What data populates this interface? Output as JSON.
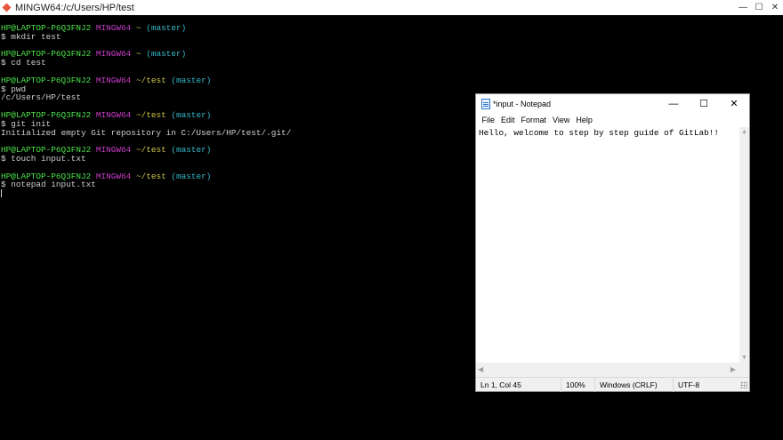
{
  "terminal": {
    "title": "MINGW64:/c/Users/HP/test",
    "lines": [
      {
        "kind": "prompt",
        "user": "HP@LAPTOP-P6Q3FNJ2",
        "sys": "MINGW64",
        "path": "~",
        "branch": "(master)"
      },
      {
        "kind": "cmd",
        "text": "$ mkdir test"
      },
      {
        "kind": "blank"
      },
      {
        "kind": "prompt",
        "user": "HP@LAPTOP-P6Q3FNJ2",
        "sys": "MINGW64",
        "path": "~",
        "branch": "(master)"
      },
      {
        "kind": "cmd",
        "text": "$ cd test"
      },
      {
        "kind": "blank"
      },
      {
        "kind": "prompt",
        "user": "HP@LAPTOP-P6Q3FNJ2",
        "sys": "MINGW64",
        "path": "~/test",
        "branch": "(master)"
      },
      {
        "kind": "cmd",
        "text": "$ pwd"
      },
      {
        "kind": "out",
        "text": "/c/Users/HP/test"
      },
      {
        "kind": "blank"
      },
      {
        "kind": "prompt",
        "user": "HP@LAPTOP-P6Q3FNJ2",
        "sys": "MINGW64",
        "path": "~/test",
        "branch": "(master)"
      },
      {
        "kind": "cmd",
        "text": "$ git init"
      },
      {
        "kind": "out",
        "text": "Initialized empty Git repository in C:/Users/HP/test/.git/"
      },
      {
        "kind": "blank"
      },
      {
        "kind": "prompt",
        "user": "HP@LAPTOP-P6Q3FNJ2",
        "sys": "MINGW64",
        "path": "~/test",
        "branch": "(master)"
      },
      {
        "kind": "cmd",
        "text": "$ touch input.txt"
      },
      {
        "kind": "blank"
      },
      {
        "kind": "prompt",
        "user": "HP@LAPTOP-P6Q3FNJ2",
        "sys": "MINGW64",
        "path": "~/test",
        "branch": "(master)"
      },
      {
        "kind": "cmd",
        "text": "$ notepad input.txt"
      },
      {
        "kind": "cursor"
      }
    ],
    "window_buttons": {
      "minimize": "—",
      "maximize": "☐",
      "close": "✕"
    }
  },
  "notepad": {
    "title": "*input - Notepad",
    "window_buttons": {
      "minimize": "—",
      "maximize": "☐",
      "close": "✕"
    },
    "menu": [
      "File",
      "Edit",
      "Format",
      "View",
      "Help"
    ],
    "content": "Hello, welcome to step by step guide of GitLab!!",
    "status": {
      "position": "Ln 1, Col 45",
      "zoom": "100%",
      "line_ending": "Windows (CRLF)",
      "encoding": "UTF-8"
    },
    "scroll_arrows": {
      "up": "▲",
      "down": "▼",
      "left": "◀",
      "right": "▶"
    }
  },
  "colors": {
    "prompt_user": "#4ce24c",
    "prompt_sys": "#c93cc9",
    "prompt_path": "#cfc44a",
    "prompt_branch": "#35b9c9",
    "terminal_bg": "#000000",
    "terminal_text": "#d0d0d0"
  }
}
